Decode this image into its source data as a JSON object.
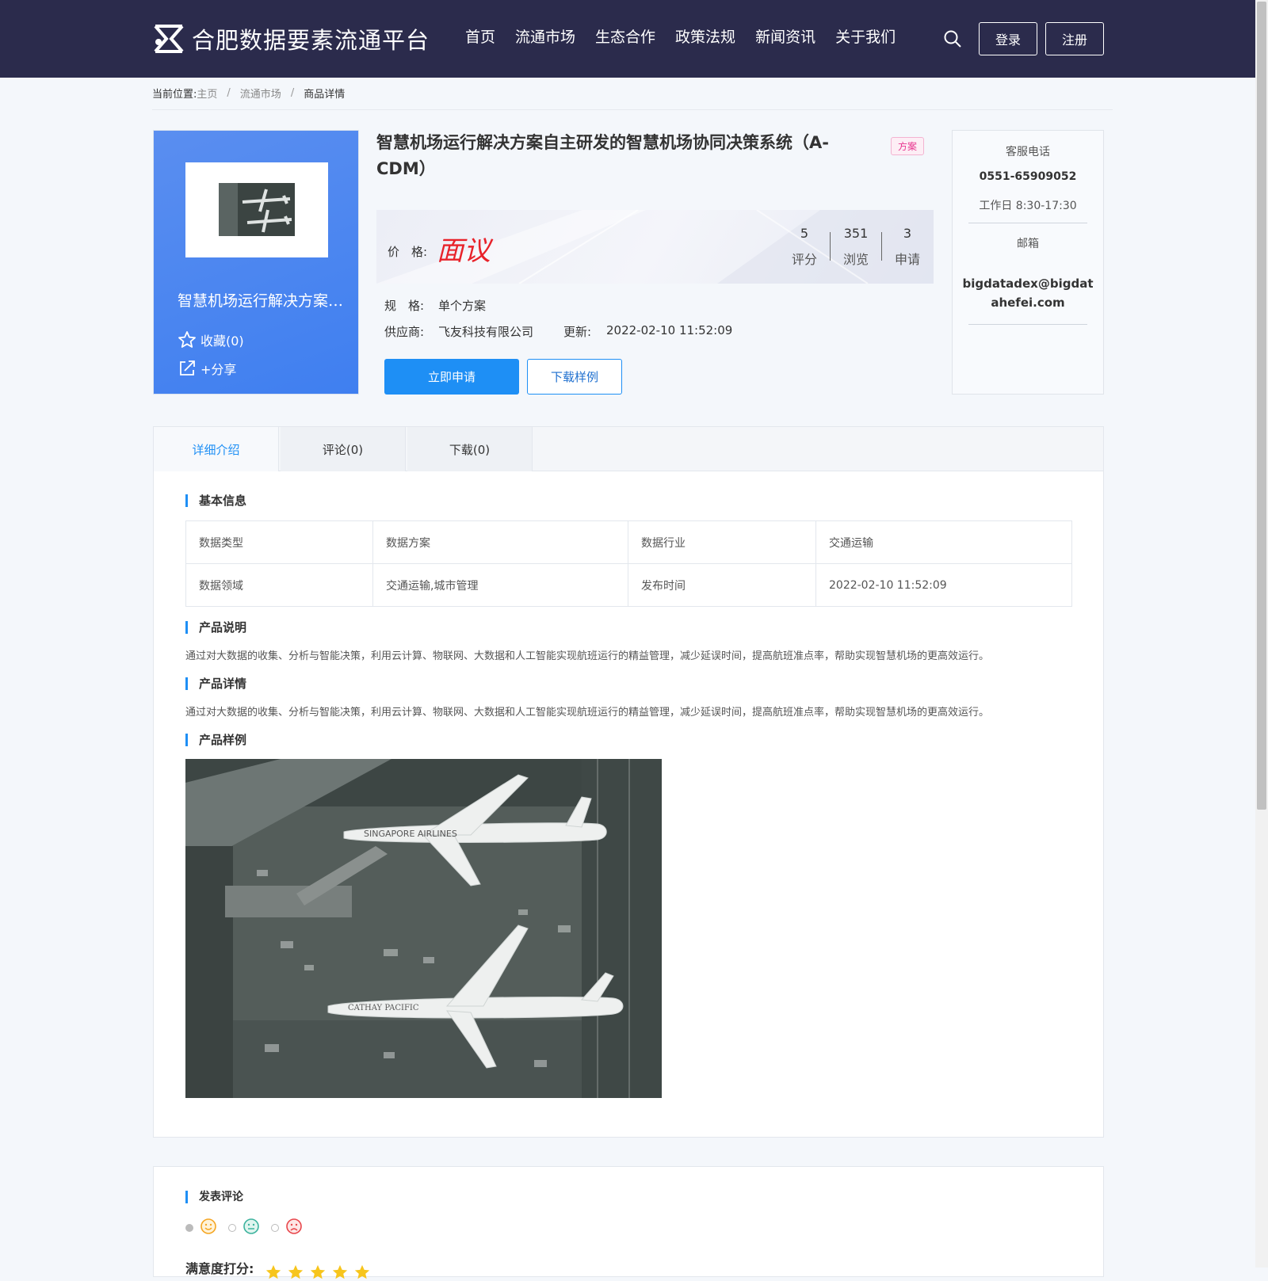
{
  "header": {
    "brand": "合肥数据要素流通平台",
    "nav": [
      "首页",
      "流通市场",
      "生态合作",
      "政策法规",
      "新闻资讯",
      "关于我们"
    ],
    "login_label": "登录",
    "register_label": "注册"
  },
  "breadcrumb": {
    "label": "当前位置:",
    "items": [
      "主页",
      "流通市场",
      "商品详情"
    ]
  },
  "product": {
    "card_title": "智慧机场运行解决方案自主研发的智慧机场协同决策系统（A-CDM）",
    "favorite_label": "收藏(0)",
    "share_label": "+分享",
    "title": "智慧机场运行解决方案自主研发的智慧机场协同决策系统（A-CDM）",
    "tag": "方案",
    "price_label": "价　格:",
    "price_value": "面议",
    "stats": [
      {
        "value": "5",
        "label": "评分"
      },
      {
        "value": "351",
        "label": "浏览"
      },
      {
        "value": "3",
        "label": "申请"
      }
    ],
    "spec_label": "规　格:",
    "spec_value": "单个方案",
    "supplier_label": "供应商:",
    "supplier_value": "飞友科技有限公司",
    "update_label": "更新:",
    "update_value": "2022-02-10 11:52:09",
    "apply_label": "立即申请",
    "download_label": "下载样例"
  },
  "contact": {
    "phone_label": "客服电话",
    "phone": "0551-65909052",
    "hours": "工作日 8:30-17:30",
    "email_label": "邮箱",
    "email_line1": "bigdatadex@bigdat",
    "email_line2": "ahefei.com"
  },
  "tabs": [
    "详细介绍",
    "评论(0)",
    "下载(0)"
  ],
  "details": {
    "basic_title": "基本信息",
    "rows": [
      [
        "数据类型",
        "数据方案",
        "数据行业",
        "交通运输"
      ],
      [
        "数据领域",
        "交通运输,城市管理",
        "发布时间",
        "2022-02-10 11:52:09"
      ]
    ],
    "desc_title": "产品说明",
    "desc_text": "通过对大数据的收集、分析与智能决策，利用云计算、物联网、大数据和人工智能实现航班运行的精益管理，减少延误时间，提高航班准点率，帮助实现智慧机场的更高效运行。",
    "detail_title": "产品详情",
    "detail_text": "通过对大数据的收集、分析与智能决策，利用云计算、物联网、大数据和人工智能实现航班运行的精益管理，减少延误时间，提高航班准点率，帮助实现智慧机场的更高效运行。",
    "sample_title": "产品样例",
    "plane1_text": "SINGAPORE AIRLINES",
    "plane2_text": "CATHAY PACIFIC"
  },
  "comment": {
    "title": "发表评论",
    "satisfaction_label": "满意度打分:",
    "rating": 5
  }
}
